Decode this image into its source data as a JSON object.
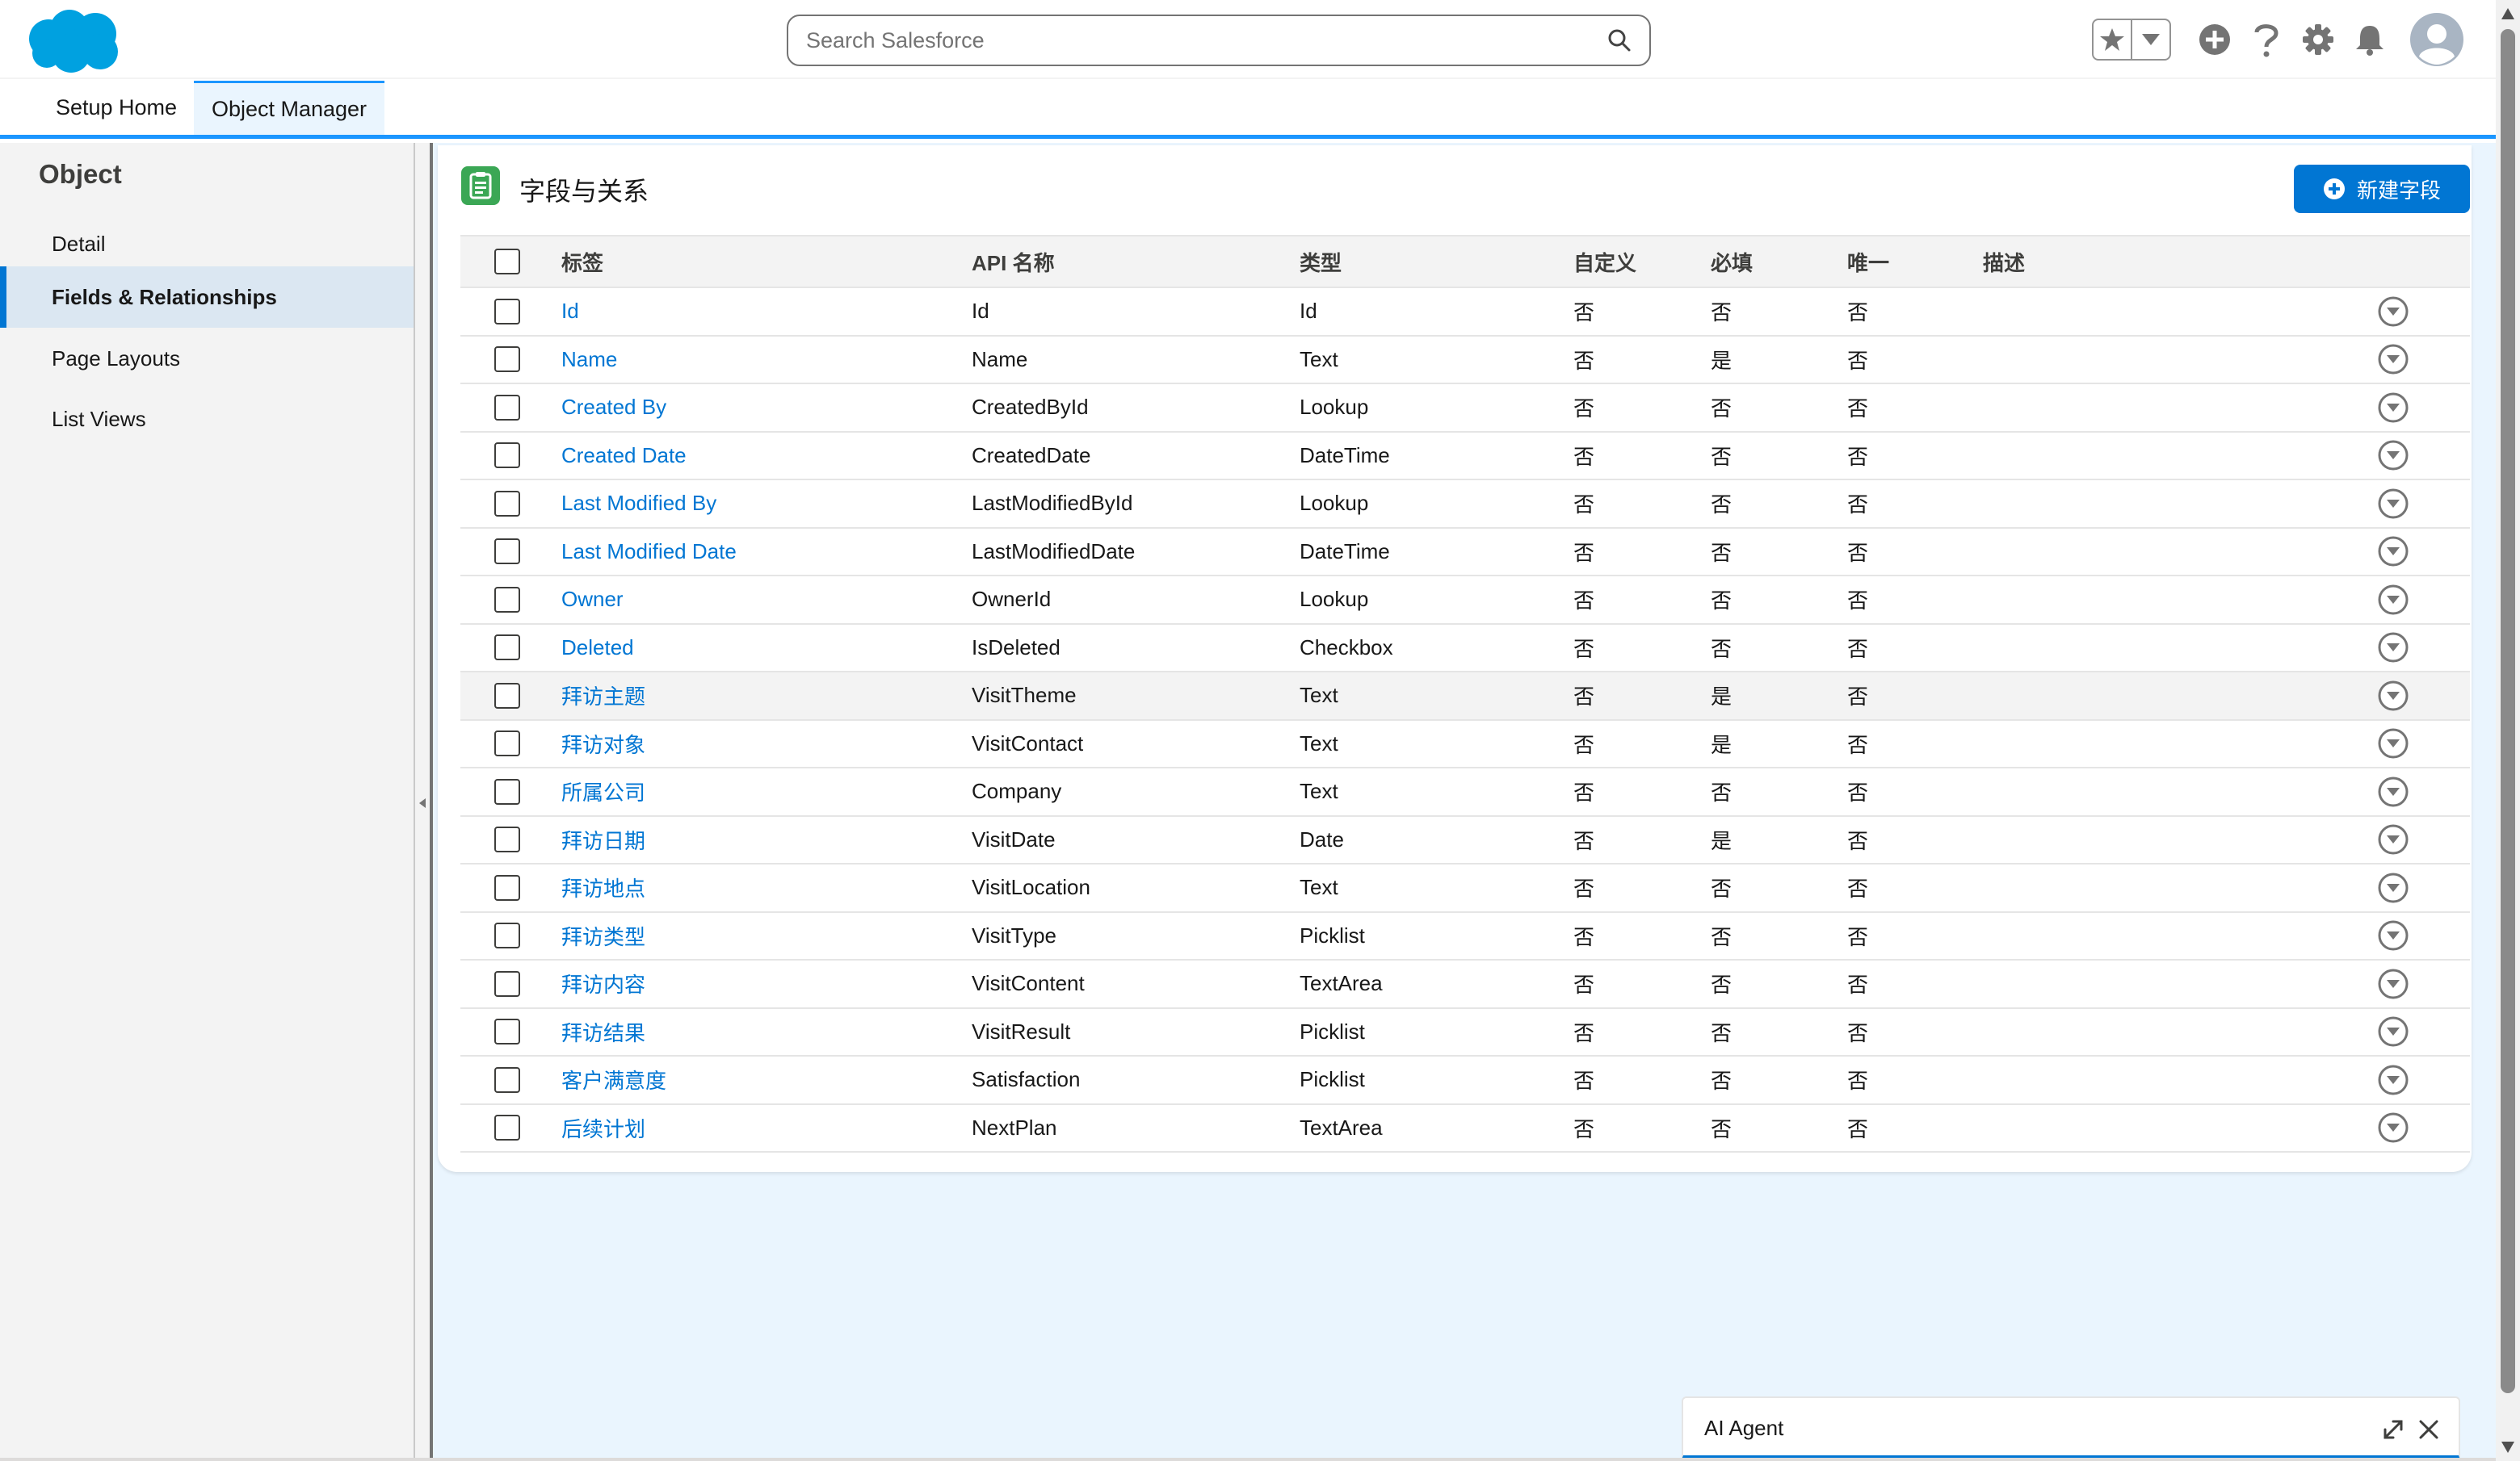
{
  "header": {
    "search_placeholder": "Search Salesforce",
    "brand_color": "#00a1e0",
    "icons": [
      "favorites-star-icon",
      "favorites-dropdown-icon",
      "global-add-icon",
      "help-icon",
      "setup-gear-icon",
      "notifications-bell-icon",
      "user-avatar-icon"
    ]
  },
  "nav": {
    "tabs": [
      {
        "label": "Setup Home",
        "active": false
      },
      {
        "label": "Object Manager",
        "active": true
      }
    ]
  },
  "sidebar": {
    "title": "Object",
    "items": [
      {
        "label": "Detail",
        "active": false
      },
      {
        "label": "Fields & Relationships",
        "active": true
      },
      {
        "label": "Page Layouts",
        "active": false
      },
      {
        "label": "List Views",
        "active": false
      }
    ]
  },
  "card": {
    "title": "字段与关系",
    "new_button_label": "新建字段",
    "accent": "#0176d3"
  },
  "table": {
    "headers": {
      "label": "标签",
      "api": "API 名称",
      "type": "类型",
      "custom": "自定义",
      "required": "必填",
      "unique": "唯一",
      "description": "描述"
    },
    "rows": [
      {
        "label": "Id",
        "api": "Id",
        "type": "Id",
        "custom": "否",
        "required": "否",
        "unique": "否"
      },
      {
        "label": "Name",
        "api": "Name",
        "type": "Text",
        "custom": "否",
        "required": "是",
        "unique": "否"
      },
      {
        "label": "Created By",
        "api": "CreatedById",
        "type": "Lookup",
        "custom": "否",
        "required": "否",
        "unique": "否"
      },
      {
        "label": "Created Date",
        "api": "CreatedDate",
        "type": "DateTime",
        "custom": "否",
        "required": "否",
        "unique": "否"
      },
      {
        "label": "Last Modified By",
        "api": "LastModifiedById",
        "type": "Lookup",
        "custom": "否",
        "required": "否",
        "unique": "否"
      },
      {
        "label": "Last Modified Date",
        "api": "LastModifiedDate",
        "type": "DateTime",
        "custom": "否",
        "required": "否",
        "unique": "否"
      },
      {
        "label": "Owner",
        "api": "OwnerId",
        "type": "Lookup",
        "custom": "否",
        "required": "否",
        "unique": "否"
      },
      {
        "label": "Deleted",
        "api": "IsDeleted",
        "type": "Checkbox",
        "custom": "否",
        "required": "否",
        "unique": "否"
      },
      {
        "label": "拜访主题",
        "api": "VisitTheme",
        "type": "Text",
        "custom": "否",
        "required": "是",
        "unique": "否"
      },
      {
        "label": "拜访对象",
        "api": "VisitContact",
        "type": "Text",
        "custom": "否",
        "required": "是",
        "unique": "否"
      },
      {
        "label": "所属公司",
        "api": "Company",
        "type": "Text",
        "custom": "否",
        "required": "否",
        "unique": "否"
      },
      {
        "label": "拜访日期",
        "api": "VisitDate",
        "type": "Date",
        "custom": "否",
        "required": "是",
        "unique": "否"
      },
      {
        "label": "拜访地点",
        "api": "VisitLocation",
        "type": "Text",
        "custom": "否",
        "required": "否",
        "unique": "否"
      },
      {
        "label": "拜访类型",
        "api": "VisitType",
        "type": "Picklist",
        "custom": "否",
        "required": "否",
        "unique": "否"
      },
      {
        "label": "拜访内容",
        "api": "VisitContent",
        "type": "TextArea",
        "custom": "否",
        "required": "否",
        "unique": "否"
      },
      {
        "label": "拜访结果",
        "api": "VisitResult",
        "type": "Picklist",
        "custom": "否",
        "required": "否",
        "unique": "否"
      },
      {
        "label": "客户满意度",
        "api": "Satisfaction",
        "type": "Picklist",
        "custom": "否",
        "required": "否",
        "unique": "否"
      },
      {
        "label": "后续计划",
        "api": "NextPlan",
        "type": "TextArea",
        "custom": "否",
        "required": "否",
        "unique": "否"
      }
    ]
  },
  "ai_agent": {
    "title": "AI Agent"
  }
}
